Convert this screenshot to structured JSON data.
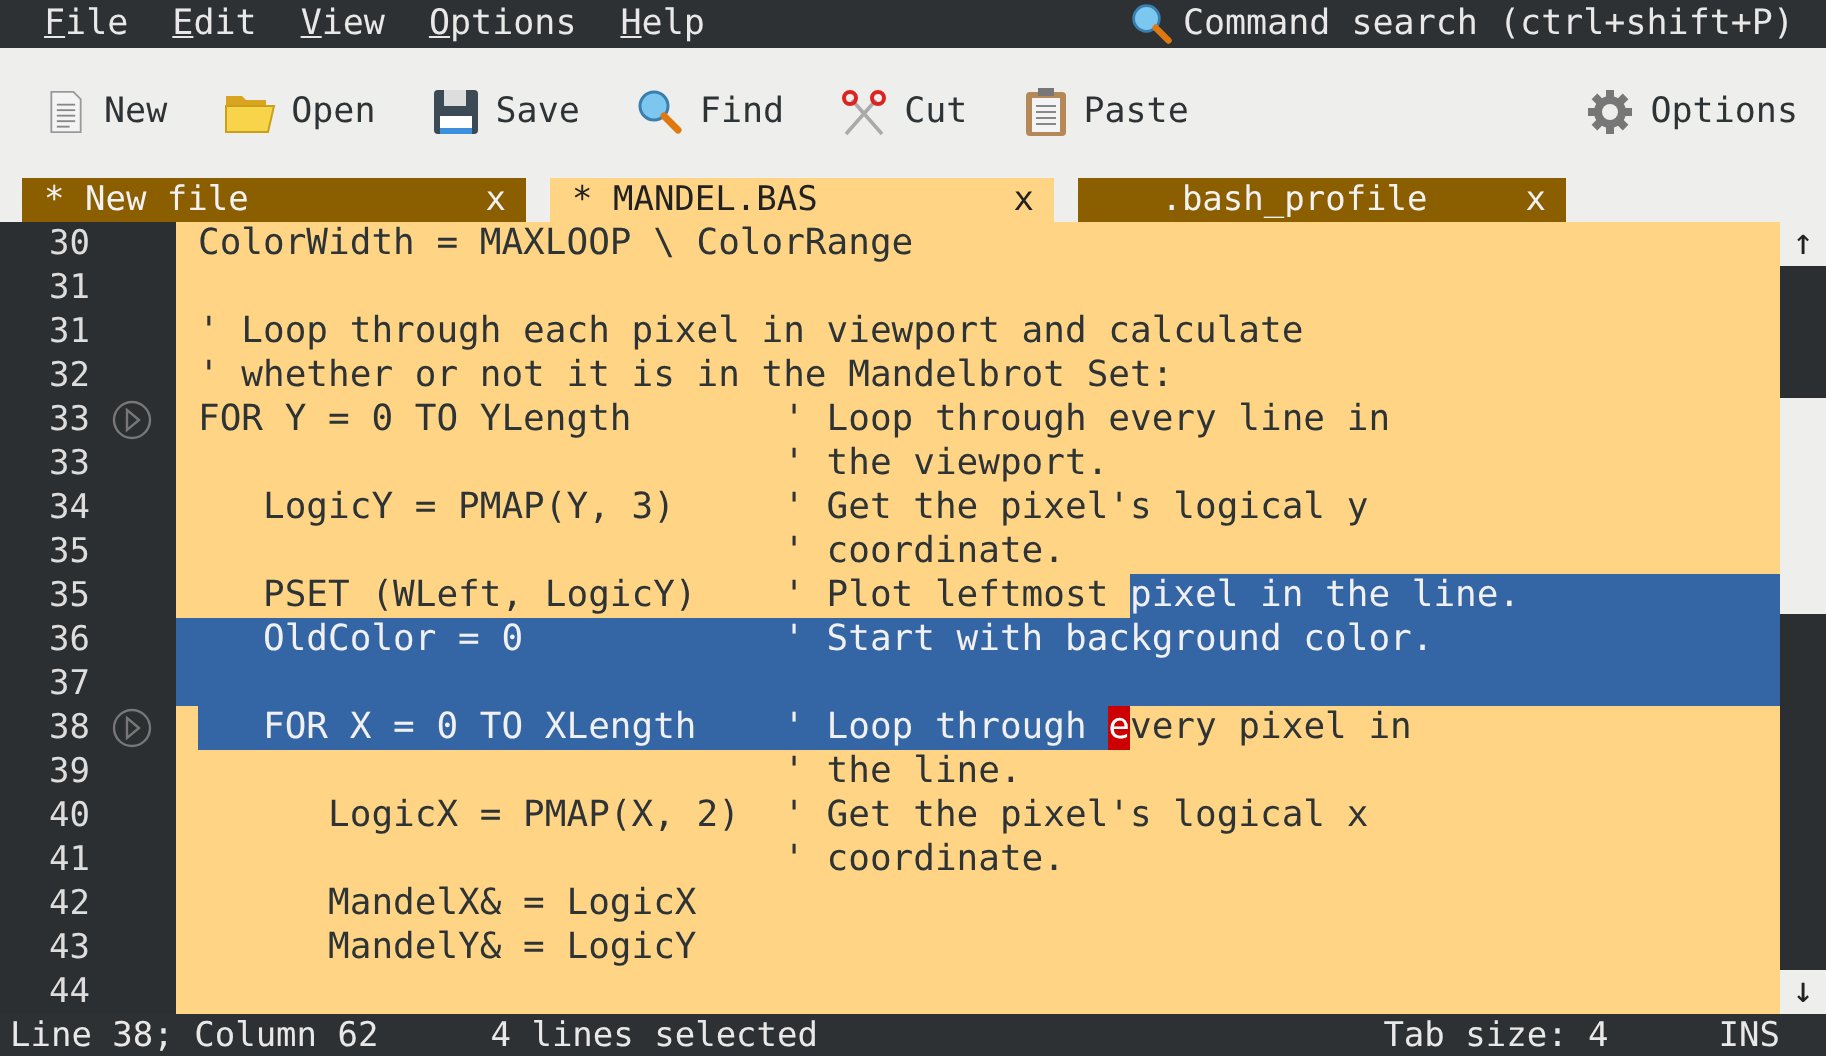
{
  "menu": [
    {
      "label": "File"
    },
    {
      "label": "Edit"
    },
    {
      "label": "View"
    },
    {
      "label": "Options"
    },
    {
      "label": "Help"
    }
  ],
  "command_search": "Command search (ctrl+shift+P)",
  "toolbar": [
    {
      "label": "New",
      "kind": "new"
    },
    {
      "label": "Open",
      "kind": "open"
    },
    {
      "label": "Save",
      "kind": "save"
    },
    {
      "label": "Find",
      "kind": "find"
    },
    {
      "label": "Cut",
      "kind": "cut"
    },
    {
      "label": "Paste",
      "kind": "paste"
    },
    {
      "label": "Options",
      "kind": "options"
    }
  ],
  "tabs": [
    {
      "label": "* New file",
      "close": "x",
      "selected": false
    },
    {
      "label": "* MANDEL.BAS",
      "close": "x",
      "selected": true
    },
    {
      "label": "   .bash_profile",
      "close": "x",
      "selected": false
    }
  ],
  "lines": [
    {
      "number": "30",
      "marker": false,
      "eol_selected": false,
      "segments": [
        {
          "kind": "text",
          "text": "ColorWidth = MAXLOOP \\ ColorRange"
        }
      ]
    },
    {
      "number": "31",
      "marker": false,
      "eol_selected": false
    },
    {
      "number": "31",
      "marker": false,
      "eol_selected": false,
      "segments": [
        {
          "kind": "text",
          "text": "' Loop through each pixel in viewport and calculate"
        }
      ]
    },
    {
      "number": "32",
      "marker": false,
      "eol_selected": false,
      "segments": [
        {
          "kind": "text",
          "text": "' whether or not it is in the Mandelbrot Set:"
        }
      ]
    },
    {
      "number": "33",
      "marker": true,
      "eol_selected": false,
      "segments": [
        {
          "kind": "text",
          "text": "FOR Y = 0 TO YLength       ' Loop through every line in"
        }
      ]
    },
    {
      "number": "33",
      "marker": false,
      "eol_selected": false,
      "segments": [
        {
          "kind": "text",
          "text": "                           ' the viewport."
        }
      ]
    },
    {
      "number": "34",
      "marker": false,
      "eol_selected": false,
      "segments": [
        {
          "kind": "text",
          "text": "   LogicY = PMAP(Y, 3)     ' Get the pixel's logical y"
        }
      ]
    },
    {
      "number": "35",
      "marker": false,
      "eol_selected": false,
      "segments": [
        {
          "kind": "text",
          "text": "                           ' coordinate."
        }
      ]
    },
    {
      "number": "35",
      "marker": false,
      "eol_selected": true,
      "segments": [
        {
          "kind": "text",
          "text": "   PSET (WLeft, LogicY)    ' Plot leftmost "
        },
        {
          "kind": "selection",
          "text": "pixel in the line."
        }
      ]
    },
    {
      "number": "36",
      "marker": false,
      "eol_selected": true,
      "segments": [
        {
          "kind": "selection",
          "text": "   OldColor = 0            ' Start with background color."
        }
      ]
    },
    {
      "number": "37",
      "marker": false,
      "eol_selected": true
    },
    {
      "number": "38",
      "marker": true,
      "eol_selected": false,
      "segments": [
        {
          "kind": "selection",
          "text": "   FOR X = 0 TO XLength    ' Loop through "
        },
        {
          "kind": "cursor",
          "text": "e"
        },
        {
          "kind": "text",
          "text": "very pixel in"
        }
      ]
    },
    {
      "number": "39",
      "marker": false,
      "eol_selected": false,
      "segments": [
        {
          "kind": "text",
          "text": "                           ' the line."
        }
      ]
    },
    {
      "number": "40",
      "marker": false,
      "eol_selected": false,
      "segments": [
        {
          "kind": "text",
          "text": "      LogicX = PMAP(X, 2)  ' Get the pixel's logical x"
        }
      ]
    },
    {
      "number": "41",
      "marker": false,
      "eol_selected": false,
      "segments": [
        {
          "kind": "text",
          "text": "                           ' coordinate."
        }
      ]
    },
    {
      "number": "42",
      "marker": false,
      "eol_selected": false,
      "segments": [
        {
          "kind": "text",
          "text": "      MandelX& = LogicX"
        }
      ]
    },
    {
      "number": "43",
      "marker": false,
      "eol_selected": false,
      "segments": [
        {
          "kind": "text",
          "text": "      MandelY& = LogicY"
        }
      ]
    },
    {
      "number": "44",
      "marker": false,
      "eol_selected": false
    }
  ],
  "scrollbar": {
    "up": "↑",
    "down": "↓"
  },
  "status_bar": {
    "position": "Line 38; Column 62",
    "selection": "4 lines selected",
    "tab_size": "Tab size: 4",
    "mode": "INS"
  }
}
